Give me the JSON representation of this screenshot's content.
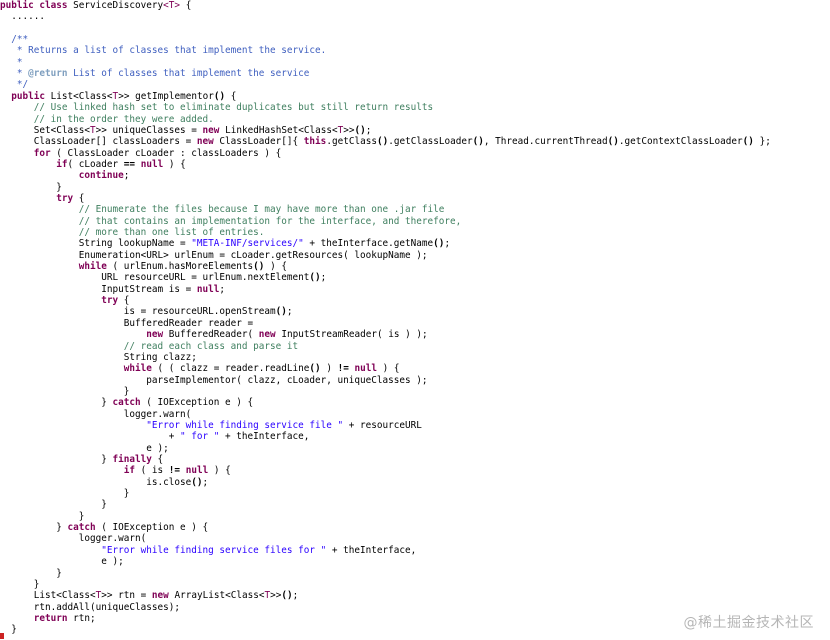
{
  "code_lines": [
    [
      [
        "kw",
        "public "
      ],
      [
        "kw",
        "class "
      ],
      [
        "pl",
        "ServiceDiscovery"
      ],
      [
        "gen",
        "<T>"
      ],
      [
        "pl",
        " {"
      ]
    ],
    [
      [
        "pl",
        "  ......"
      ]
    ],
    [
      [
        "pl",
        ""
      ]
    ],
    [
      [
        "doc",
        "  /**"
      ]
    ],
    [
      [
        "doc",
        "   * Returns a list of classes that implement the service."
      ]
    ],
    [
      [
        "doc",
        "   *"
      ]
    ],
    [
      [
        "doc",
        "   * "
      ],
      [
        "dtg",
        "@return"
      ],
      [
        "doc",
        " List of classes that implement the service"
      ]
    ],
    [
      [
        "doc",
        "   */"
      ]
    ],
    [
      [
        "pl",
        "  "
      ],
      [
        "kw",
        "public "
      ],
      [
        "pl",
        "List<Class<"
      ],
      [
        "gen",
        "T"
      ],
      [
        "pl",
        ">> "
      ],
      [
        "pl",
        "getImplementor"
      ],
      [
        "fn",
        "()"
      ],
      [
        "pl",
        " {"
      ]
    ],
    [
      [
        "cm",
        "      // Use linked hash set to eliminate duplicates but still return results"
      ]
    ],
    [
      [
        "cm",
        "      // in the order they were added."
      ]
    ],
    [
      [
        "pl",
        "      Set<Class<"
      ],
      [
        "gen",
        "T"
      ],
      [
        "pl",
        ">> uniqueClasses = "
      ],
      [
        "kw",
        "new "
      ],
      [
        "pl",
        "LinkedHashSet<Class<"
      ],
      [
        "gen",
        "T"
      ],
      [
        "pl",
        ">>"
      ],
      [
        "fn",
        "()"
      ],
      [
        "pl",
        ";"
      ]
    ],
    [
      [
        "pl",
        "      ClassLoader[] classLoaders = "
      ],
      [
        "kw",
        "new "
      ],
      [
        "pl",
        "ClassLoader[]{ "
      ],
      [
        "kw",
        "this"
      ],
      [
        "pl",
        ".getClass"
      ],
      [
        "fn",
        "()"
      ],
      [
        "pl",
        ".getClassLoader"
      ],
      [
        "fn",
        "()"
      ],
      [
        "pl",
        ", Thread.currentThread"
      ],
      [
        "fn",
        "()"
      ],
      [
        "pl",
        ".getContextClassLoader"
      ],
      [
        "fn",
        "()"
      ],
      [
        "pl",
        " };"
      ]
    ],
    [
      [
        "pl",
        "      "
      ],
      [
        "kw",
        "for "
      ],
      [
        "pl",
        "( ClassLoader cLoader : classLoaders ) {"
      ]
    ],
    [
      [
        "pl",
        "          "
      ],
      [
        "kw",
        "if"
      ],
      [
        "pl",
        "( cLoader "
      ],
      [
        "fn",
        "=="
      ],
      [
        "pl",
        " "
      ],
      [
        "kw",
        "null "
      ],
      [
        "pl",
        ") {"
      ]
    ],
    [
      [
        "pl",
        "              "
      ],
      [
        "kw",
        "continue"
      ],
      [
        "pl",
        ";"
      ]
    ],
    [
      [
        "pl",
        "          }"
      ]
    ],
    [
      [
        "pl",
        "          "
      ],
      [
        "kw",
        "try "
      ],
      [
        "pl",
        "{"
      ]
    ],
    [
      [
        "cm",
        "              // Enumerate the files because I may have more than one .jar file"
      ]
    ],
    [
      [
        "cm",
        "              // that contains an implementation for the interface, and therefore,"
      ]
    ],
    [
      [
        "cm",
        "              // more than one list of entries."
      ]
    ],
    [
      [
        "pl",
        "              String lookupName = "
      ],
      [
        "str",
        "\"META-INF/services/\""
      ],
      [
        "pl",
        " + theInterface.getName"
      ],
      [
        "fn",
        "()"
      ],
      [
        "pl",
        ";"
      ]
    ],
    [
      [
        "pl",
        "              Enumeration<URL> urlEnum = cLoader.getResources( lookupName );"
      ]
    ],
    [
      [
        "pl",
        "              "
      ],
      [
        "kw",
        "while "
      ],
      [
        "pl",
        "( urlEnum.hasMoreElements"
      ],
      [
        "fn",
        "()"
      ],
      [
        "pl",
        " ) {"
      ]
    ],
    [
      [
        "pl",
        "                  URL resourceURL = urlEnum.nextElement"
      ],
      [
        "fn",
        "()"
      ],
      [
        "pl",
        ";"
      ]
    ],
    [
      [
        "pl",
        "                  InputStream is = "
      ],
      [
        "kw",
        "null"
      ],
      [
        "pl",
        ";"
      ]
    ],
    [
      [
        "pl",
        "                  "
      ],
      [
        "kw",
        "try "
      ],
      [
        "pl",
        "{"
      ]
    ],
    [
      [
        "pl",
        "                      is = resourceURL.openStream"
      ],
      [
        "fn",
        "()"
      ],
      [
        "pl",
        ";"
      ]
    ],
    [
      [
        "pl",
        "                      BufferedReader reader ="
      ]
    ],
    [
      [
        "pl",
        "                          "
      ],
      [
        "kw",
        "new "
      ],
      [
        "pl",
        "BufferedReader( "
      ],
      [
        "kw",
        "new "
      ],
      [
        "pl",
        "InputStreamReader( is ) );"
      ]
    ],
    [
      [
        "cm",
        "                      // read each class and parse it"
      ]
    ],
    [
      [
        "pl",
        "                      String clazz;"
      ]
    ],
    [
      [
        "pl",
        "                      "
      ],
      [
        "kw",
        "while "
      ],
      [
        "pl",
        "( ( clazz = reader.readLine"
      ],
      [
        "fn",
        "()"
      ],
      [
        "pl",
        " ) "
      ],
      [
        "fn",
        "!="
      ],
      [
        "pl",
        " "
      ],
      [
        "kw",
        "null "
      ],
      [
        "pl",
        ") {"
      ]
    ],
    [
      [
        "pl",
        "                          parseImplementor( clazz, cLoader, uniqueClasses );"
      ]
    ],
    [
      [
        "pl",
        "                      }"
      ]
    ],
    [
      [
        "pl",
        "                  } "
      ],
      [
        "kw",
        "catch "
      ],
      [
        "pl",
        "( IOException e ) {"
      ]
    ],
    [
      [
        "pl",
        "                      logger.warn("
      ]
    ],
    [
      [
        "pl",
        "                          "
      ],
      [
        "str",
        "\"Error while finding service file \""
      ],
      [
        "pl",
        " + resourceURL"
      ]
    ],
    [
      [
        "pl",
        "                              + "
      ],
      [
        "str",
        "\" for \""
      ],
      [
        "pl",
        " + theInterface,"
      ]
    ],
    [
      [
        "pl",
        "                          e );"
      ]
    ],
    [
      [
        "pl",
        "                  } "
      ],
      [
        "kw",
        "finally "
      ],
      [
        "pl",
        "{"
      ]
    ],
    [
      [
        "pl",
        "                      "
      ],
      [
        "kw",
        "if "
      ],
      [
        "pl",
        "( is "
      ],
      [
        "fn",
        "!="
      ],
      [
        "pl",
        " "
      ],
      [
        "kw",
        "null "
      ],
      [
        "pl",
        ") {"
      ]
    ],
    [
      [
        "pl",
        "                          is.close"
      ],
      [
        "fn",
        "()"
      ],
      [
        "pl",
        ";"
      ]
    ],
    [
      [
        "pl",
        "                      }"
      ]
    ],
    [
      [
        "pl",
        "                  }"
      ]
    ],
    [
      [
        "pl",
        "              }"
      ]
    ],
    [
      [
        "pl",
        "          } "
      ],
      [
        "kw",
        "catch "
      ],
      [
        "pl",
        "( IOException e ) {"
      ]
    ],
    [
      [
        "pl",
        "              logger.warn("
      ]
    ],
    [
      [
        "pl",
        "                  "
      ],
      [
        "str",
        "\"Error while finding service files for \""
      ],
      [
        "pl",
        " + theInterface,"
      ]
    ],
    [
      [
        "pl",
        "                  e );"
      ]
    ],
    [
      [
        "pl",
        "          }"
      ]
    ],
    [
      [
        "pl",
        "      }"
      ]
    ],
    [
      [
        "pl",
        "      List<Class<"
      ],
      [
        "gen",
        "T"
      ],
      [
        "pl",
        ">> rtn = "
      ],
      [
        "kw",
        "new "
      ],
      [
        "pl",
        "ArrayList<Class<"
      ],
      [
        "gen",
        "T"
      ],
      [
        "pl",
        ">>"
      ],
      [
        "fn",
        "()"
      ],
      [
        "pl",
        ";"
      ]
    ],
    [
      [
        "pl",
        "      rtn.addAll(uniqueClasses);"
      ]
    ],
    [
      [
        "pl",
        "      "
      ],
      [
        "kw",
        "return "
      ],
      [
        "pl",
        "rtn;"
      ]
    ],
    [
      [
        "pl",
        "  }"
      ]
    ]
  ],
  "watermark": "@稀土掘金技术社区",
  "colors": {
    "keyword": "#7f0055",
    "comment": "#3f7f5f",
    "javadoc": "#3f5fbf",
    "string": "#2a00ff",
    "background": "#ffffff"
  }
}
